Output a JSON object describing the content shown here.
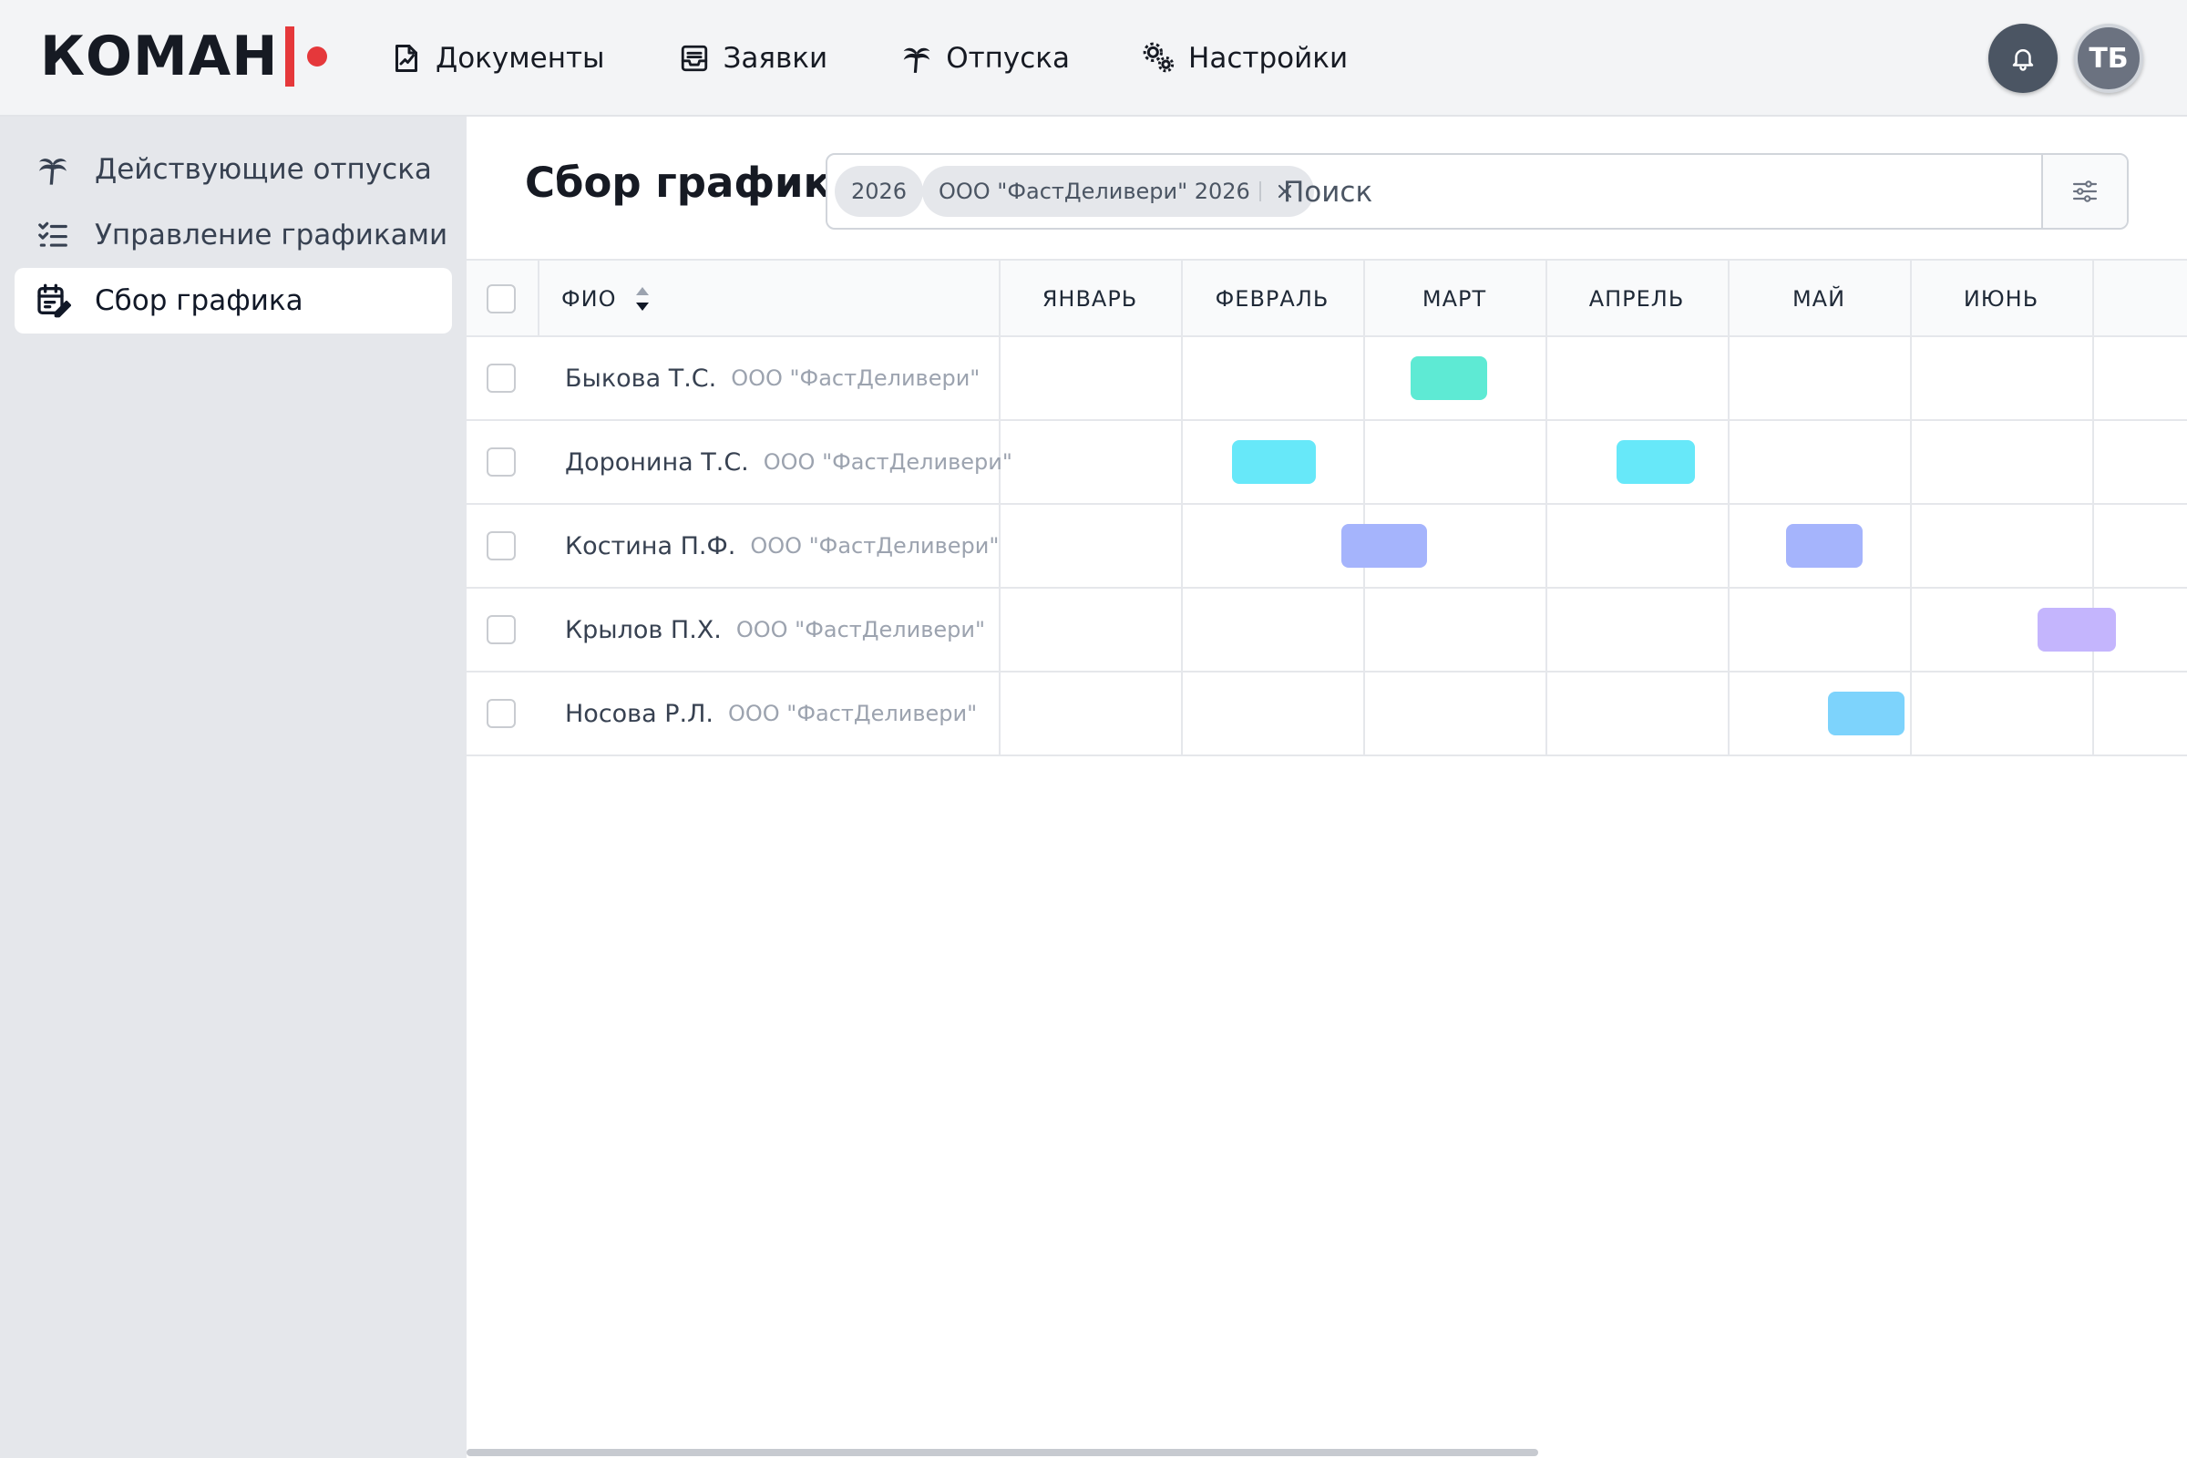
{
  "logo": {
    "text": "КОМАН"
  },
  "nav": [
    {
      "label": "Документы",
      "icon": "document-chart-icon"
    },
    {
      "label": "Заявки",
      "icon": "inbox-icon"
    },
    {
      "label": "Отпуска",
      "icon": "palm-tree-icon"
    },
    {
      "label": "Настройки",
      "icon": "gears-icon"
    }
  ],
  "user": {
    "initials": "ТБ"
  },
  "sidebar": {
    "items": [
      {
        "label": "Действующие отпуска",
        "icon": "palm-tree-icon"
      },
      {
        "label": "Управление графиками",
        "icon": "checklist-icon"
      },
      {
        "label": "Сбор графика",
        "icon": "calendar-edit-icon",
        "active": true
      }
    ]
  },
  "page": {
    "title": "Сбор графика"
  },
  "search": {
    "chips": [
      {
        "label": "2026"
      },
      {
        "label": "ООО \"ФастДеливери\" 2026"
      }
    ],
    "placeholder": "Поиск"
  },
  "table": {
    "fio_header": "ФИО",
    "months": [
      "ЯНВАРЬ",
      "ФЕВРАЛЬ",
      "МАРТ",
      "АПРЕЛЬ",
      "МАЙ",
      "ИЮНЬ"
    ],
    "rows": [
      {
        "name": "Быкова Т.С.",
        "org": "ООО \"ФастДеливери\"",
        "color": "#5eead4",
        "vacations": [
          {
            "month": 2,
            "start": 0.26,
            "end": 0.68
          }
        ]
      },
      {
        "name": "Доронина Т.С.",
        "org": "ООО \"ФастДеливери\"",
        "color": "#67e8f9",
        "vacations": [
          {
            "month": 1,
            "start": 0.28,
            "end": 0.74
          },
          {
            "month": 3,
            "start": 0.39,
            "end": 0.82
          }
        ]
      },
      {
        "name": "Костина П.Ф.",
        "org": "ООО \"ФастДеливери\"",
        "color": "#a5b4fc",
        "vacations": [
          {
            "month": 1,
            "start": 0.88,
            "end": 1.35
          },
          {
            "month": 4,
            "start": 0.32,
            "end": 0.74
          }
        ]
      },
      {
        "name": "Крылов П.Х.",
        "org": "ООО \"ФастДеливери\"",
        "color": "#c4b5fd",
        "vacations": [
          {
            "month": 5,
            "start": 0.7,
            "end": 1.13
          }
        ]
      },
      {
        "name": "Носова Р.Л.",
        "org": "ООО \"ФастДеливери\"",
        "color": "#7dd3fc",
        "vacations": [
          {
            "month": 4,
            "start": 0.55,
            "end": 0.97
          }
        ]
      }
    ]
  }
}
